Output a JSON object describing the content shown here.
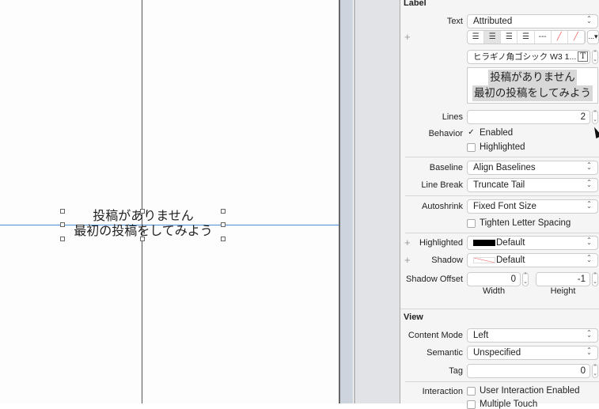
{
  "canvas": {
    "label_lines": [
      "投稿がありません",
      "最初の投稿をしてみよう"
    ]
  },
  "inspector": {
    "label_section": "Label",
    "text": {
      "label": "Text",
      "value": "Attributed"
    },
    "alignment": {
      "icons": [
        "align-left-icon",
        "align-center-icon",
        "align-right-icon",
        "align-justify-icon",
        "align-natural-icon",
        "no-color-icon",
        "no-strike-icon"
      ],
      "more": "...▾"
    },
    "font": {
      "value": "ヒラギノ角ゴシック W3 1..."
    },
    "preview": [
      "投稿がありません",
      "最初の投稿をしてみよう"
    ],
    "lines": {
      "label": "Lines",
      "value": "2"
    },
    "behavior": {
      "label": "Behavior",
      "enabled": "Enabled",
      "highlighted": "Highlighted"
    },
    "baseline": {
      "label": "Baseline",
      "value": "Align Baselines"
    },
    "line_break": {
      "label": "Line Break",
      "value": "Truncate Tail"
    },
    "autoshrink": {
      "label": "Autoshrink",
      "value": "Fixed Font Size",
      "tighten": "Tighten Letter Spacing"
    },
    "highlighted_color": {
      "label": "Highlighted",
      "value": "Default",
      "swatch": "#000000"
    },
    "shadow": {
      "label": "Shadow",
      "value": "Default"
    },
    "shadow_offset": {
      "label": "Shadow Offset",
      "width": "0",
      "height": "-1",
      "width_label": "Width",
      "height_label": "Height"
    },
    "view_section": "View",
    "content_mode": {
      "label": "Content Mode",
      "value": "Left"
    },
    "semantic": {
      "label": "Semantic",
      "value": "Unspecified"
    },
    "tag": {
      "label": "Tag",
      "value": "0"
    },
    "interaction": {
      "label": "Interaction",
      "user_interaction": "User Interaction Enabled",
      "multiple_touch": "Multiple Touch"
    }
  }
}
